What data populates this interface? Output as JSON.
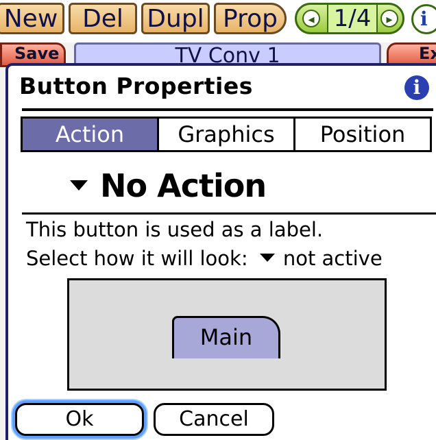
{
  "toolbar": {
    "new_label": "New",
    "del_label": "Del",
    "dupl_label": "Dupl",
    "prop_label": "Prop",
    "page_indicator": "1/4",
    "prev_icon": "chevron-left-icon",
    "next_icon": "chevron-right-icon",
    "info_icon": "info-icon",
    "save_label": "Save",
    "title_field": "TV Conv 1",
    "exit_label": "Exit"
  },
  "dialog": {
    "title": "Button Properties",
    "info_icon": "info-icon",
    "tabs": [
      {
        "label": "Action",
        "active": true
      },
      {
        "label": "Graphics",
        "active": false
      },
      {
        "label": "Position",
        "active": false
      }
    ],
    "action_select": "No Action",
    "description": "This button is used as a label.",
    "look_prompt": "Select how it will look:",
    "look_select": "not active",
    "preview_label": "Main",
    "ok_label": "Ok",
    "cancel_label": "Cancel"
  },
  "colors": {
    "active_tab": "#6c6ca8",
    "preview_button": "#a8a8d8",
    "preview_background": "#dcdcdc",
    "focus_ring": "#60a0ff"
  }
}
